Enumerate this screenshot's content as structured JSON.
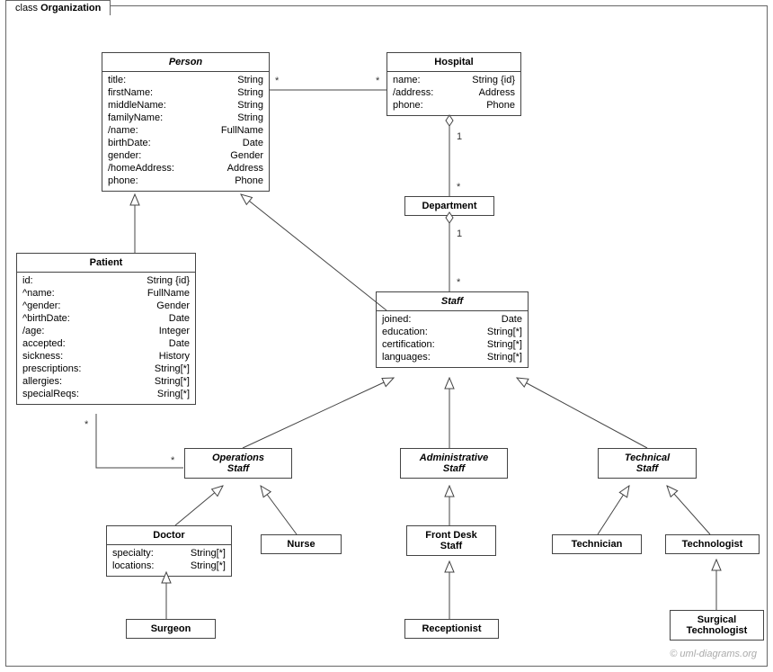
{
  "frame": {
    "keyword": "class",
    "name": "Organization"
  },
  "classes": {
    "person": {
      "name": "Person",
      "attrs": [
        {
          "n": "title:",
          "t": "String"
        },
        {
          "n": "firstName:",
          "t": "String"
        },
        {
          "n": "middleName:",
          "t": "String"
        },
        {
          "n": "familyName:",
          "t": "String"
        },
        {
          "n": "/name:",
          "t": "FullName"
        },
        {
          "n": "birthDate:",
          "t": "Date"
        },
        {
          "n": "gender:",
          "t": "Gender"
        },
        {
          "n": "/homeAddress:",
          "t": "Address"
        },
        {
          "n": "phone:",
          "t": "Phone"
        }
      ]
    },
    "hospital": {
      "name": "Hospital",
      "attrs": [
        {
          "n": "name:",
          "t": "String {id}"
        },
        {
          "n": "/address:",
          "t": "Address"
        },
        {
          "n": "phone:",
          "t": "Phone"
        }
      ]
    },
    "department": {
      "name": "Department"
    },
    "patient": {
      "name": "Patient",
      "attrs": [
        {
          "n": "id:",
          "t": "String {id}"
        },
        {
          "n": "^name:",
          "t": "FullName"
        },
        {
          "n": "^gender:",
          "t": "Gender"
        },
        {
          "n": "^birthDate:",
          "t": "Date"
        },
        {
          "n": "/age:",
          "t": "Integer"
        },
        {
          "n": "accepted:",
          "t": "Date"
        },
        {
          "n": "sickness:",
          "t": "History"
        },
        {
          "n": "prescriptions:",
          "t": "String[*]"
        },
        {
          "n": "allergies:",
          "t": "String[*]"
        },
        {
          "n": "specialReqs:",
          "t": "Sring[*]"
        }
      ]
    },
    "staff": {
      "name": "Staff",
      "attrs": [
        {
          "n": "joined:",
          "t": "Date"
        },
        {
          "n": "education:",
          "t": "String[*]"
        },
        {
          "n": "certification:",
          "t": "String[*]"
        },
        {
          "n": "languages:",
          "t": "String[*]"
        }
      ]
    },
    "opsStaff": {
      "name1": "Operations",
      "name2": "Staff"
    },
    "adminStaff": {
      "name1": "Administrative",
      "name2": "Staff"
    },
    "techStaff": {
      "name1": "Technical",
      "name2": "Staff"
    },
    "doctor": {
      "name": "Doctor",
      "attrs": [
        {
          "n": "specialty:",
          "t": "String[*]"
        },
        {
          "n": "locations:",
          "t": "String[*]"
        }
      ]
    },
    "nurse": {
      "name": "Nurse"
    },
    "frontDesk": {
      "name1": "Front Desk",
      "name2": "Staff"
    },
    "technician": {
      "name": "Technician"
    },
    "technologist": {
      "name": "Technologist"
    },
    "surgeon": {
      "name": "Surgeon"
    },
    "receptionist": {
      "name": "Receptionist"
    },
    "surgTech": {
      "name1": "Surgical",
      "name2": "Technologist"
    }
  },
  "mult": {
    "person_hosp_left": "*",
    "person_hosp_right": "*",
    "hosp_dept_top": "1",
    "hosp_dept_bot": "*",
    "dept_staff_top": "1",
    "dept_staff_bot": "*",
    "patient_ops_left": "*",
    "patient_ops_right": "*"
  },
  "copyright": "© uml-diagrams.org"
}
